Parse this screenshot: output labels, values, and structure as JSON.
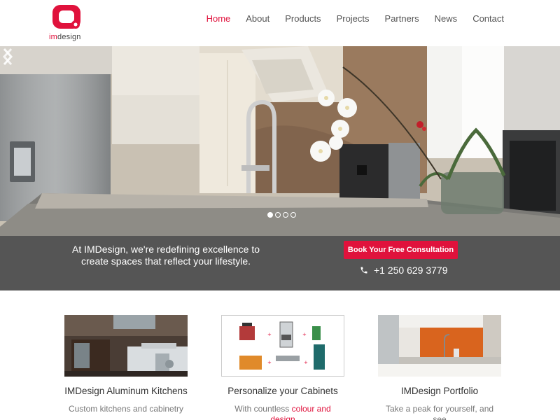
{
  "brand": {
    "logo_im": "im",
    "logo_design": "design",
    "accent_color": "#e0123c"
  },
  "nav": {
    "items": [
      {
        "label": "Home",
        "active": true
      },
      {
        "label": "About",
        "active": false
      },
      {
        "label": "Products",
        "active": false
      },
      {
        "label": "Projects",
        "active": false
      },
      {
        "label": "Partners",
        "active": false
      },
      {
        "label": "News",
        "active": false
      },
      {
        "label": "Contact",
        "active": false
      }
    ]
  },
  "hero": {
    "slide_count": 4,
    "active_slide": 1,
    "prev_icon": "chevron-left-icon",
    "next_icon": "chevron-right-icon"
  },
  "cta": {
    "tagline": "At IMDesign, we're redefining excellence to create spaces that reflect your lifestyle.",
    "button_label": "Book Your Free Consultation",
    "phone": "+1 250 629 3779",
    "phone_icon": "phone-icon"
  },
  "features": [
    {
      "title": "IMDesign Aluminum Kitchens",
      "desc": "Custom kitchens and cabinetry"
    },
    {
      "title": "Personalize your Cabinets",
      "desc_prefix": "With countless ",
      "desc_highlight": "colour and design"
    },
    {
      "title": "IMDesign Portfolio",
      "desc": "Take a peak for yourself, and see"
    }
  ]
}
